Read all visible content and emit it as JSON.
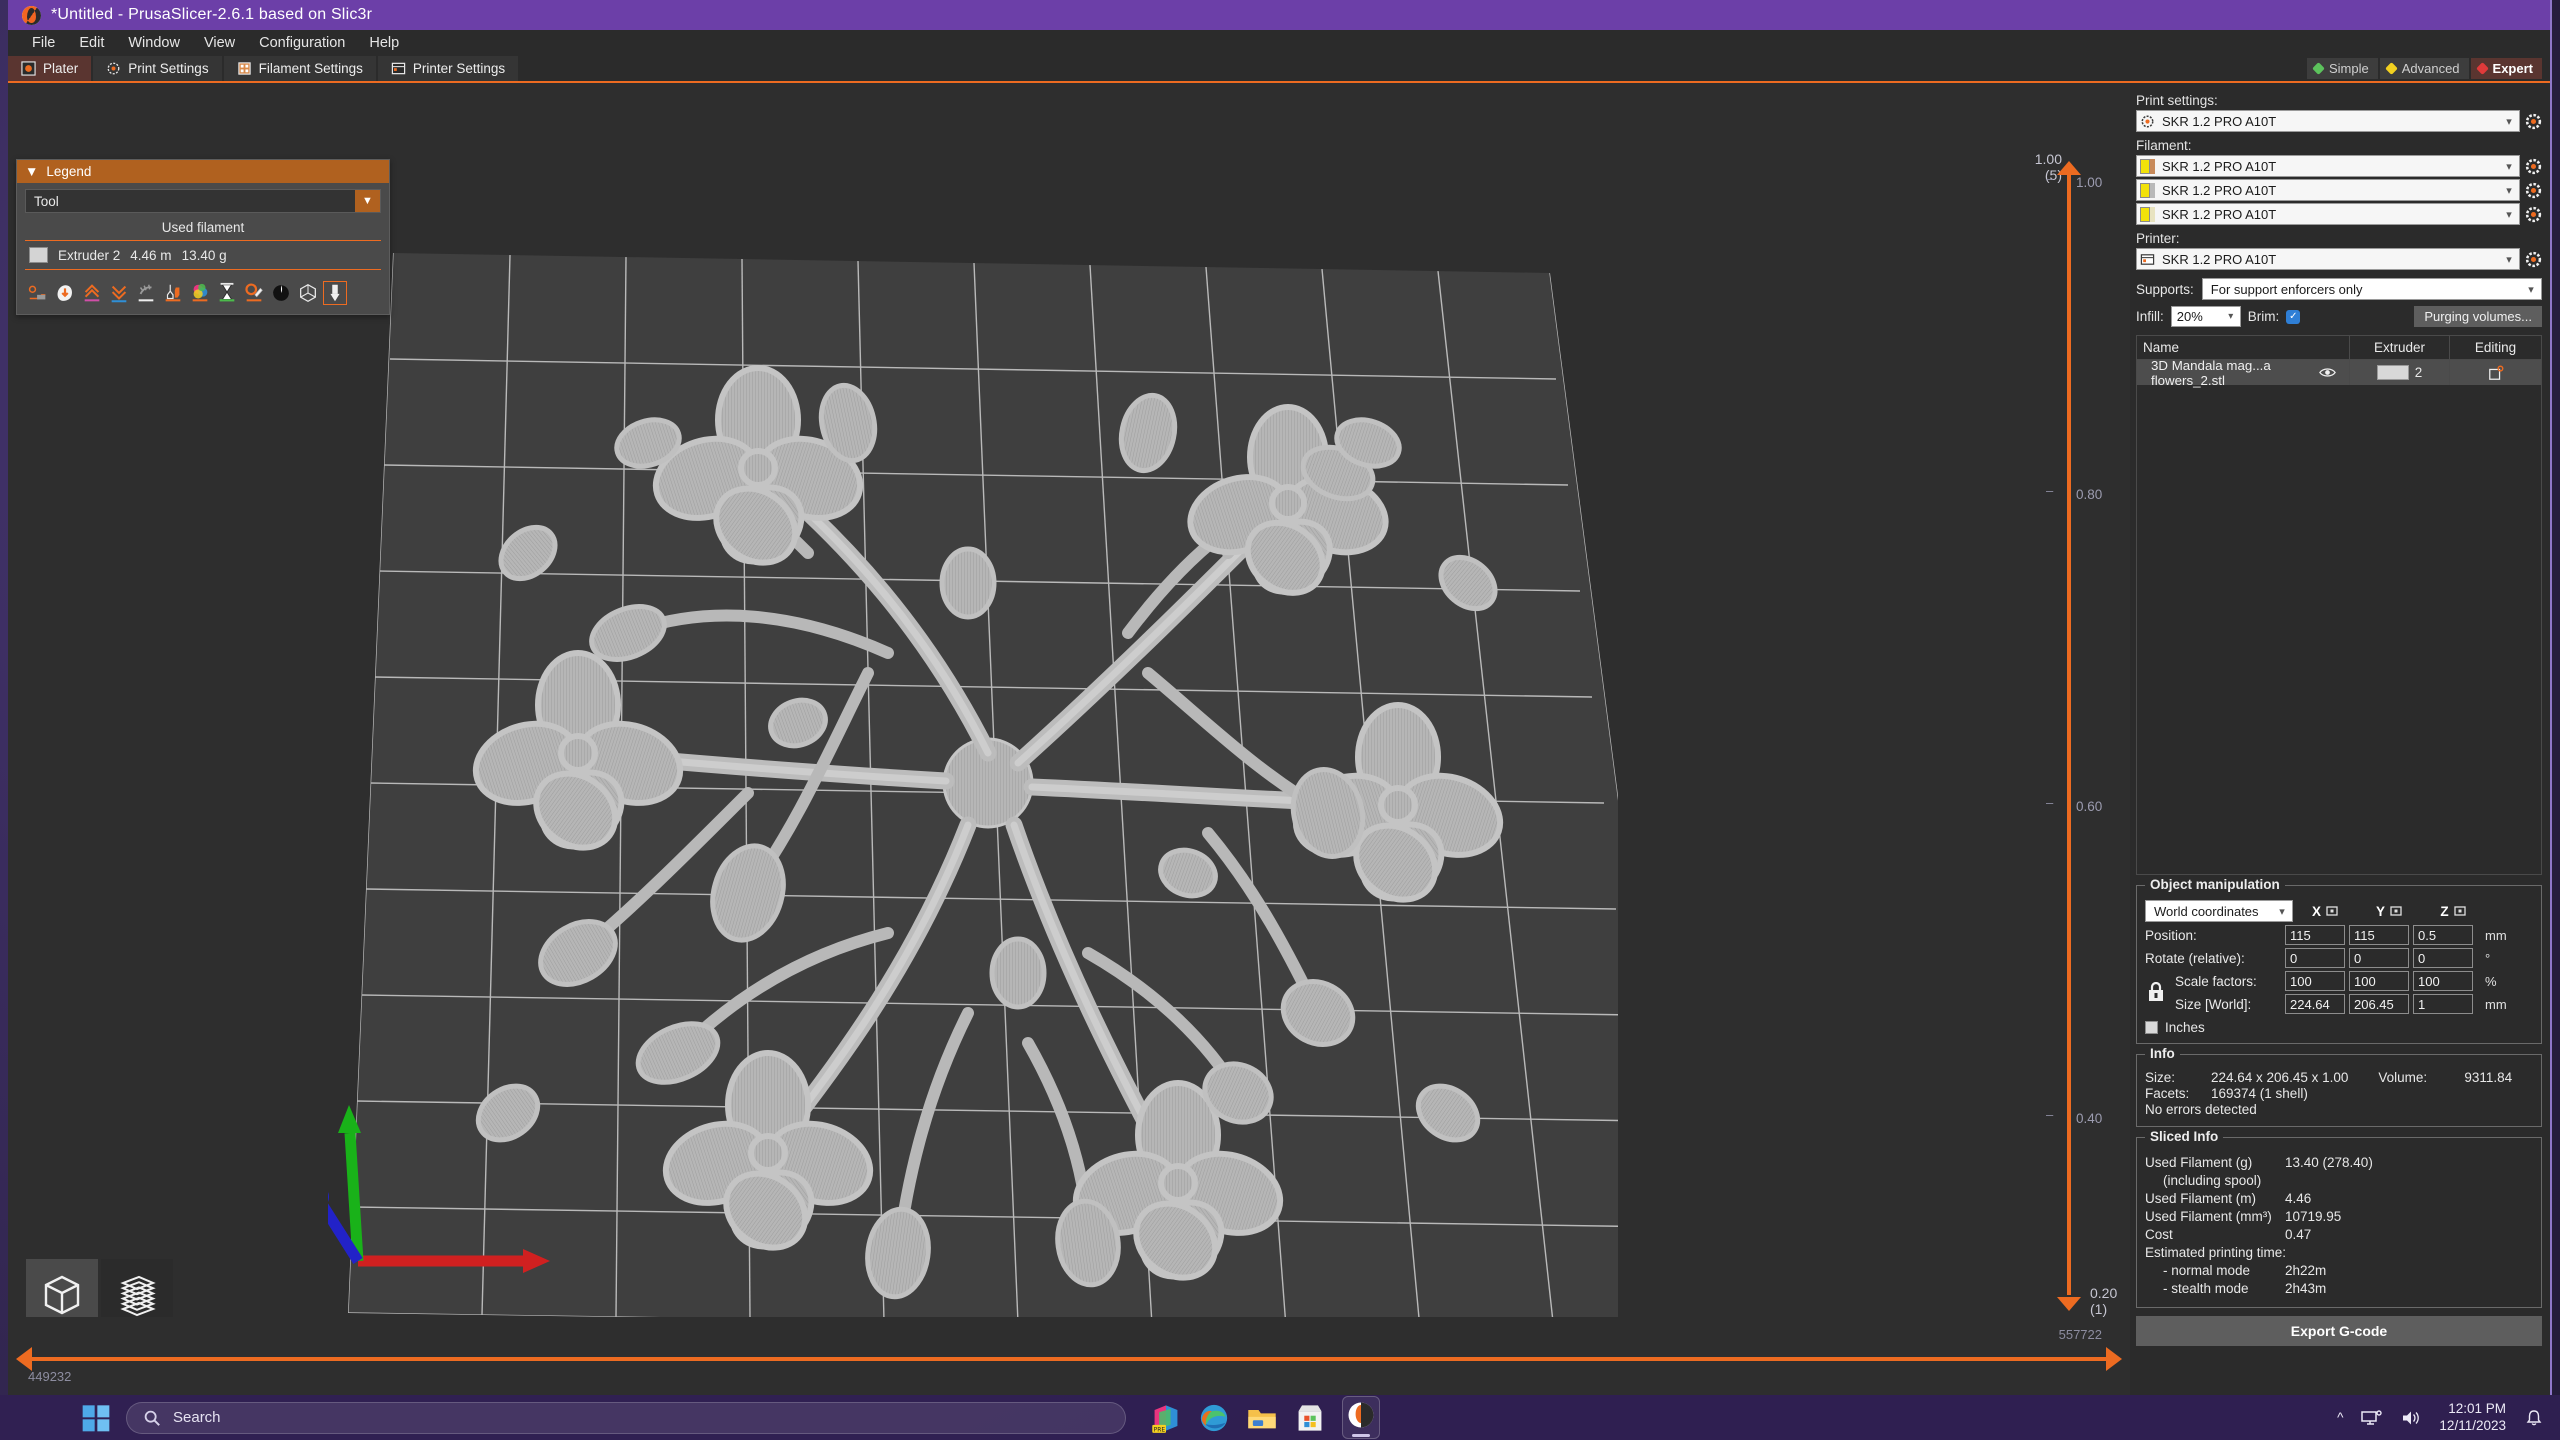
{
  "window": {
    "title": "*Untitled - PrusaSlicer-2.6.1 based on Slic3r",
    "logo_icon": "prusaslicer-logo-icon"
  },
  "menu": {
    "items": [
      {
        "label": "File"
      },
      {
        "label": "Edit"
      },
      {
        "label": "Window"
      },
      {
        "label": "View"
      },
      {
        "label": "Configuration"
      },
      {
        "label": "Help"
      }
    ]
  },
  "tabs": [
    {
      "label": "Plater",
      "icon": "plater-icon",
      "active": true
    },
    {
      "label": "Print Settings",
      "icon": "print-settings-icon",
      "active": false
    },
    {
      "label": "Filament Settings",
      "icon": "filament-settings-icon",
      "active": false
    },
    {
      "label": "Printer Settings",
      "icon": "printer-settings-icon",
      "active": false
    }
  ],
  "modes": [
    {
      "label": "Simple",
      "color": "#5cc25c",
      "active": false
    },
    {
      "label": "Advanced",
      "color": "#f2d020",
      "active": false
    },
    {
      "label": "Expert",
      "color": "#e03a3a",
      "active": true
    }
  ],
  "legend": {
    "title": "Legend",
    "collapse_icon": "triangle-down-icon",
    "view_type": "Tool",
    "column_header": "Used filament",
    "rows": [
      {
        "swatch_color": "#d4d4d4",
        "name": "Extruder 2",
        "length": "4.46 m",
        "weight": "13.40 g"
      }
    ],
    "feature_icons": [
      "travel-icon",
      "retractions-icon",
      "seams-icon",
      "deretractions-icon",
      "wipe-icon",
      "tool-changes-icon",
      "color-changes-icon",
      "pause-prints-icon",
      "custom-gcodes-icon",
      "shells-icon",
      "legend-icon",
      "tool-marker-icon"
    ]
  },
  "viewport": {
    "view_toggles": [
      {
        "name": "3d-editor-view",
        "icon": "cube-icon",
        "active": false
      },
      {
        "name": "preview-view",
        "icon": "layers-icon",
        "active": true
      }
    ],
    "axes": {
      "x_color": "#d02020",
      "y_color": "#19b219",
      "z_color": "#2222c8"
    },
    "plate_color": "#3f3f3f",
    "grid_color": "#c8c8c8",
    "toolpath_color": "#b4b4b4"
  },
  "layer_slider": {
    "top_value": "1.00",
    "top_layer": "(5)",
    "bottom_value": "0.20",
    "bottom_layer": "(1)",
    "ticks": [
      "1.00",
      "0.80",
      "0.60",
      "0.40"
    ],
    "lock_icon": "open-lock-icon",
    "gear_icon": "gear-icon"
  },
  "moves_slider": {
    "left_value": "449232",
    "right_value": "557722"
  },
  "sidebar": {
    "print_settings_label": "Print settings:",
    "print_settings_preset": "SKR 1.2 PRO A10T",
    "filament_label": "Filament:",
    "filament_presets": [
      {
        "value": "SKR 1.2 PRO A10T",
        "color": "#f2e209",
        "second_color": "#c88a5a"
      },
      {
        "value": "SKR 1.2 PRO A10T",
        "color": "#f2e209",
        "second_color": "#b9b9b9"
      },
      {
        "value": "SKR 1.2 PRO A10T",
        "color": "#f2e209",
        "second_color": "#e8e3c0"
      }
    ],
    "printer_label": "Printer:",
    "printer_preset": "SKR 1.2 PRO A10T",
    "supports_label": "Supports:",
    "supports_value": "For support enforcers only",
    "infill_label": "Infill:",
    "infill_value": "20%",
    "brim_label": "Brim:",
    "brim_checked": true,
    "purging_button": "Purging volumes..."
  },
  "object_list": {
    "columns": [
      "Name",
      "",
      "Extruder",
      "Editing"
    ],
    "rows": [
      {
        "name": "3D Mandala mag...a flowers_2.stl",
        "eye_icon": "eye-icon",
        "extruder": "2",
        "extruder_color": "#d8d8d8",
        "editing_icon": "edit-layers-icon"
      }
    ]
  },
  "object_manipulation": {
    "title": "Object manipulation",
    "coordinate_space": "World coordinates",
    "axes": [
      "X",
      "Y",
      "Z"
    ],
    "axis_icon": "reset-axis-icon",
    "rows": [
      {
        "label": "Position:",
        "values": [
          "115",
          "115",
          "0.5"
        ],
        "unit": "mm",
        "indent": false
      },
      {
        "label": "Rotate (relative):",
        "values": [
          "0",
          "0",
          "0"
        ],
        "unit": "°",
        "indent": false
      },
      {
        "label": "Scale factors:",
        "values": [
          "100",
          "100",
          "100"
        ],
        "unit": "%",
        "indent": true
      },
      {
        "label": "Size [World]:",
        "values": [
          "224.64",
          "206.45",
          "1"
        ],
        "unit": "mm",
        "indent": true
      }
    ],
    "lock_icon": "closed-lock-icon",
    "inches_label": "Inches",
    "inches_checked": false
  },
  "info": {
    "title": "Info",
    "size_label": "Size:",
    "size_value": "224.64 x 206.45 x 1.00",
    "volume_label": "Volume:",
    "volume_value": "9311.84",
    "facets_label": "Facets:",
    "facets_value": "169374 (1 shell)",
    "errors": "No errors detected"
  },
  "sliced_info": {
    "title": "Sliced Info",
    "rows": [
      {
        "label": "Used Filament (g)",
        "value": "13.40 (278.40)",
        "indent": false
      },
      {
        "label": "(including spool)",
        "value": "",
        "indent": true
      },
      {
        "label": "Used Filament (m)",
        "value": "4.46",
        "indent": false
      },
      {
        "label": "Used Filament (mm³)",
        "value": "10719.95",
        "indent": false
      },
      {
        "label": "Cost",
        "value": "0.47",
        "indent": false
      },
      {
        "label": "Estimated printing time:",
        "value": "",
        "indent": false
      },
      {
        "label": "- normal mode",
        "value": "2h22m",
        "indent": true
      },
      {
        "label": "- stealth mode",
        "value": "2h43m",
        "indent": true
      }
    ]
  },
  "export_button": "Export G-code",
  "taskbar": {
    "start_icon": "windows-start-icon",
    "search_placeholder": "Search",
    "search_icon": "search-icon",
    "apps": [
      {
        "name": "office-icon"
      },
      {
        "name": "edge-icon"
      },
      {
        "name": "file-explorer-icon"
      },
      {
        "name": "microsoft-store-icon"
      },
      {
        "name": "prusaslicer-taskbar-icon",
        "active": true
      }
    ],
    "tray": {
      "chevron_icon": "show-hidden-icons-icon",
      "network_icon": "network-icon",
      "volume_icon": "volume-icon",
      "time": "12:01 PM",
      "date": "12/11/2023",
      "notification_icon": "notifications-icon"
    }
  }
}
